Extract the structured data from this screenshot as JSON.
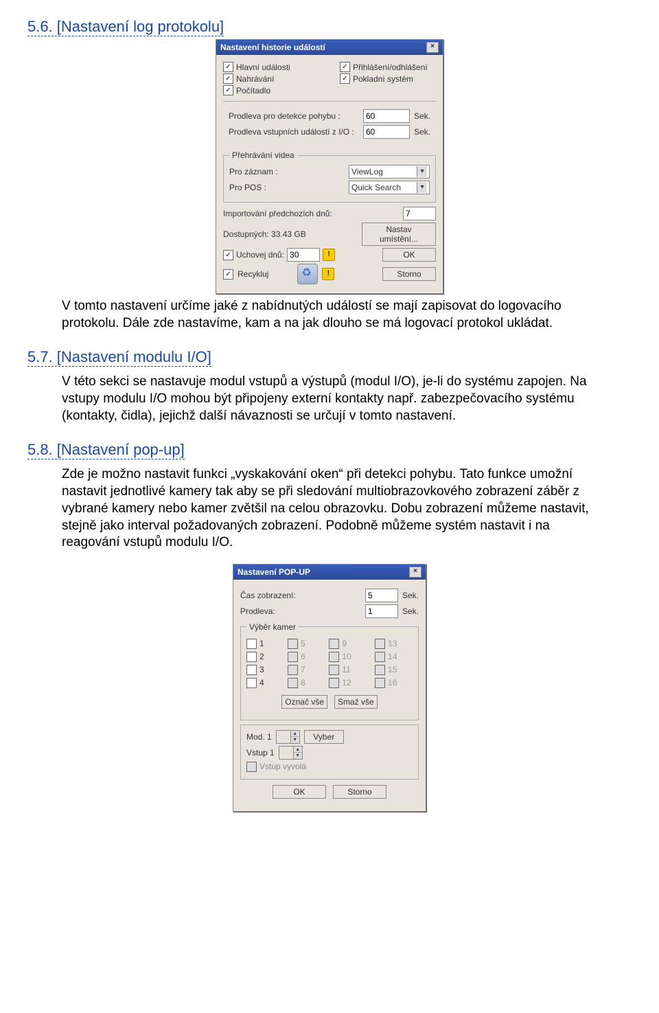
{
  "sections": {
    "s56": {
      "title": "5.6. [Nastavení log protokolu]"
    },
    "s57": {
      "title": "5.7. [Nastavení modulu I/O]"
    },
    "s58": {
      "title": "5.8. [Nastavení pop-up]"
    }
  },
  "paragraphs": {
    "p56": "V tomto nastavení určíme jaké z nabídnutých událostí se mají zapisovat do logovacího protokolu. Dále zde nastavíme, kam a na jak dlouho se má logovací protokol ukládat.",
    "p57": "V této sekci se nastavuje modul vstupů a výstupů (modul I/O), je-li do systému zapojen. Na vstupy modulu I/O mohou být připojeny externí kontakty např. zabezpečovacího systému (kontakty, čidla), jejichž další návaznosti se určují v tomto nastavení.",
    "p58": "Zde je možno nastavit funkci „vyskakování oken“ při detekci pohybu. Tato funkce umožní nastavit jednotlivé kamery tak aby se při sledování multiobrazovkového zobrazení záběr z vybrané kamery nebo kamer zvětšil na celou obrazovku. Dobu zobrazení můžeme nastavit, stejně jako interval požadovaných zobrazení. Podobně můžeme systém nastavit i na reagování vstupů modulu I/O."
  },
  "dialog1": {
    "title": "Nastavení historie událostí",
    "close": "×",
    "checks": {
      "hlavni": "Hlavní události",
      "prihlaseni": "Přihlášení/odhlášení",
      "nahravani": "Nahrávání",
      "pokladni": "Pokladní systém",
      "pocitadlo": "Počítadlo"
    },
    "prodleva_pohyb_label": "Prodleva pro detekce pohybu :",
    "prodleva_pohyb_value": "60",
    "prodleva_io_label": "Prodleva vstupních událostí z I/O :",
    "prodleva_io_value": "60",
    "sek": "Sek.",
    "prehravani_legend": "Přehrávání videa",
    "pro_zaznam_label": "Pro záznam :",
    "pro_zaznam_value": "ViewLog",
    "pro_pos_label": "Pro POS :",
    "pro_pos_value": "Quick Search",
    "import_label": "Importování předchozích dnů:",
    "import_value": "7",
    "dostupnych": "Dostupných: 33.43 GB",
    "nastav_umisteni": "Nastav umístění...",
    "uchovej_label": "Uchovej dnů:",
    "uchovej_value": "30",
    "recykluj": "Recykluj",
    "ok": "OK",
    "storno": "Storno",
    "warn": "!"
  },
  "dialog2": {
    "title": "Nastavení POP-UP",
    "close": "×",
    "cas_label": "Čas zobrazení:",
    "cas_value": "5",
    "prodleva_label": "Prodleva:",
    "prodleva_value": "1",
    "sek": "Sek.",
    "vyber_kamer_legend": "Výběr kamer",
    "cams": [
      "1",
      "2",
      "3",
      "4",
      "5",
      "6",
      "7",
      "8",
      "9",
      "10",
      "11",
      "12",
      "13",
      "14",
      "15",
      "16"
    ],
    "cams_enabled": [
      true,
      true,
      true,
      true,
      false,
      false,
      false,
      false,
      false,
      false,
      false,
      false,
      false,
      false,
      false,
      false
    ],
    "oznac_vse": "Označ vše",
    "smaz_vse": "Smaž vše",
    "mod1": "Mod. 1",
    "vyber": "Vyber",
    "vstup1": "Vstup 1",
    "vstup_vyvola": "Vstup vyvolá",
    "ok": "OK",
    "storno": "Storno"
  }
}
